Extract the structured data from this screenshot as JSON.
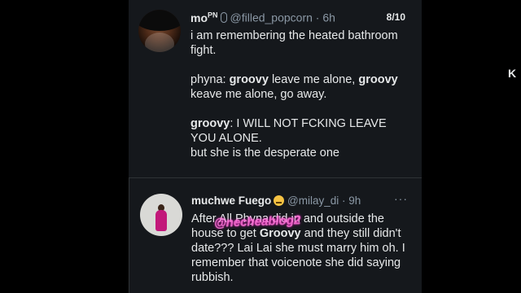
{
  "tweet": {
    "display_name": "mo",
    "name_superscript": "PN",
    "handle": "@filled_popcorn",
    "time": "6h",
    "counter": "8/10",
    "lines": {
      "l1": "i am remembering the heated bathroom",
      "l2": "fight.",
      "l3_speaker": "phyna: ",
      "l3_a": "groovy",
      "l3_b": " leave me alone, ",
      "l3_c": "groovy",
      "l4": "keave me alone, go away.",
      "l5_speaker": "groovy",
      "l5_rest": ": I WILL NOT FCKING LEAVE",
      "l6": "YOU ALONE.",
      "l7": "but she is the desperate one"
    }
  },
  "quote": {
    "display_name": "muchwe Fuego",
    "handle": "@milay_di",
    "time": "9h",
    "more_label": "···",
    "body_a": "After All Phyna did in and outside the house to get ",
    "body_bold": "Groovy",
    "body_b": " and they still didn't date??? Lai Lai she must marry him oh. I remember that voicenote she did saying rubbish."
  },
  "watermark": "@necheablog2",
  "edge_text": "K",
  "icons": {
    "avatar1": "profile-avatar",
    "mic": "microphone-icon",
    "emoji": "neutral-face-emoji-icon",
    "more": "more-options-icon"
  },
  "colors": {
    "background": "#000000",
    "panel": "#15181c",
    "text": "#e7e9ea",
    "muted": "#8b98a5",
    "watermark": "#ff6bd6"
  }
}
